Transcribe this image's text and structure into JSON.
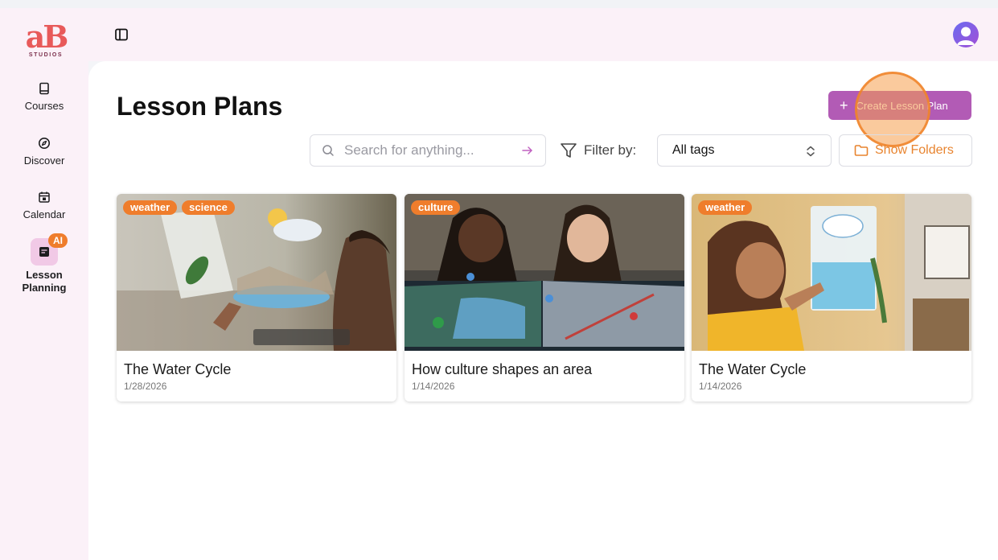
{
  "brand": {
    "logo_text": "aB",
    "logo_sub": "STUDIOS",
    "primary": "#b25bb5",
    "accent": "#ef7d2c"
  },
  "sidebar": {
    "items": [
      {
        "label": "Courses",
        "icon": "book-icon"
      },
      {
        "label": "Discover",
        "icon": "compass-icon"
      },
      {
        "label": "Calendar",
        "icon": "calendar-icon"
      },
      {
        "label": "Lesson\nPlanning",
        "icon": "lesson-plan-icon",
        "badge": "AI",
        "active": true
      }
    ]
  },
  "header": {
    "toggle_icon": "sidebar-toggle-icon",
    "avatar_icon": "user-avatar-icon"
  },
  "main": {
    "title": "Lesson Plans",
    "create_label": "Create Lesson Plan",
    "search": {
      "placeholder": "Search for anything..."
    },
    "filter_label": "Filter by:",
    "tag_select": {
      "value": "All tags"
    },
    "folders_label": "Show Folders",
    "cards": [
      {
        "title": "The Water Cycle",
        "date": "1/28/2026",
        "tags": [
          "weather",
          "science"
        ]
      },
      {
        "title": "How culture shapes an area",
        "date": "1/14/2026",
        "tags": [
          "culture"
        ]
      },
      {
        "title": "The Water Cycle",
        "date": "1/14/2026",
        "tags": [
          "weather"
        ]
      }
    ]
  }
}
